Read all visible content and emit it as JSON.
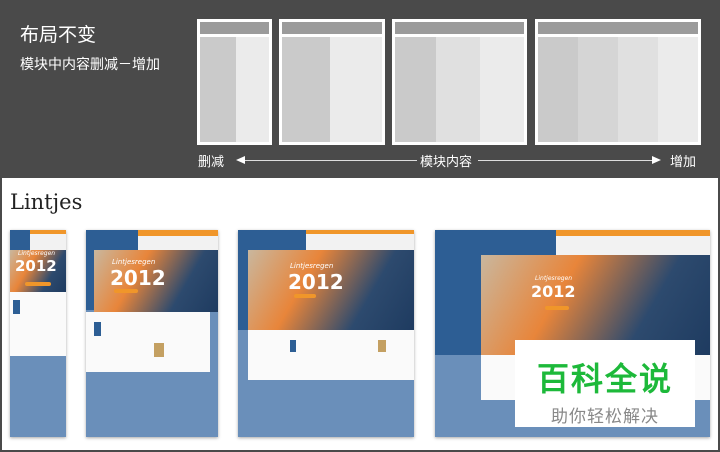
{
  "diagram": {
    "title": "布局不变",
    "subtitle": "模块中内容删减－增加",
    "label_left": "删减",
    "label_center": "模块内容",
    "label_right": "增加"
  },
  "section": {
    "title": "Lintjes",
    "hero_year": "2012",
    "hero_word": "Lintjesregen"
  },
  "watermark": {
    "brand": "百科全说",
    "slogan": "助你轻松解决"
  }
}
